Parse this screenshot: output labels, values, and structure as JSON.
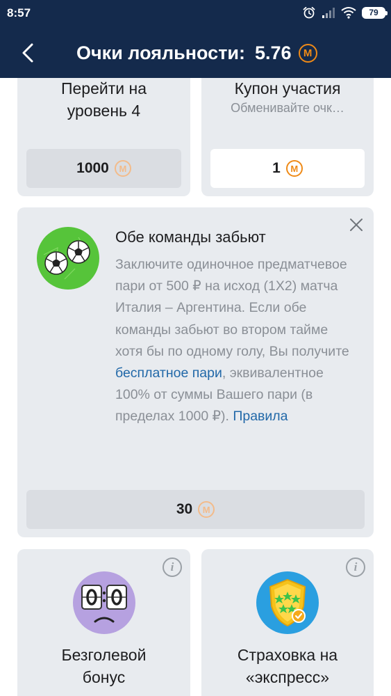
{
  "status_bar": {
    "time": "8:57",
    "battery": "79"
  },
  "header": {
    "title": "Очки лояльности:",
    "points": "5.76",
    "coin_symbol": "M"
  },
  "cards_top": [
    {
      "title_line1": "Перейти на",
      "title_line2": "уровень 4",
      "price": "1000"
    },
    {
      "title": "Купон участия",
      "subtitle": "Обменивайте очк…",
      "price": "1"
    }
  ],
  "promo": {
    "title": "Обе команды забьют",
    "desc_part1": "Заключите одиночное предматчевое пари от 500 ₽ на исход (1X2) матча Италия – Аргентина. Если обе команды забьют во втором тайме хотя бы по одному голу, Вы получите ",
    "link_free_bet": "бесплатное пари",
    "desc_part2": ", эквивалентное 100% от суммы Вашего пари (в пределах 1000 ₽). ",
    "link_rules": "Правила",
    "price": "30"
  },
  "cards_bottom": [
    {
      "title_line1": "Безголевой",
      "title_line2": "бонус",
      "info": "i"
    },
    {
      "title_line1": "Страховка на",
      "title_line2": "«экспресс»",
      "info": "i"
    }
  ],
  "colors": {
    "header_bg": "#142a4c",
    "card_bg": "#e8ebef",
    "coin": "#ef8a17",
    "link": "#2168a8"
  },
  "icons": [
    "alarm-icon",
    "signal-icon",
    "wifi-icon",
    "battery-icon",
    "back-arrow-icon",
    "coin-icon",
    "close-icon",
    "soccer-balls-icon",
    "scoreboard-sad-icon",
    "shield-stars-icon",
    "info-icon"
  ]
}
